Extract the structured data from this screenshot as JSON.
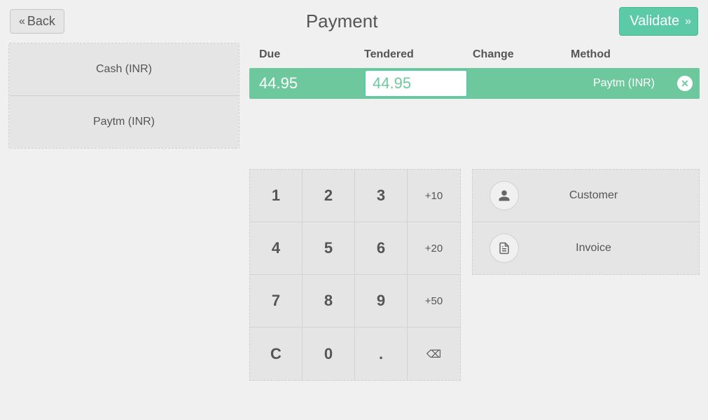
{
  "header": {
    "back_label": "Back",
    "title": "Payment",
    "validate_label": "Validate"
  },
  "methods": {
    "items": [
      {
        "label": "Cash (INR)"
      },
      {
        "label": "Paytm (INR)"
      }
    ]
  },
  "columns": {
    "due": "Due",
    "tendered": "Tendered",
    "change": "Change",
    "method": "Method"
  },
  "paymentline": {
    "due": "44.95",
    "tendered": "44.95",
    "change": "",
    "method": "Paytm (INR)"
  },
  "numpad": {
    "k1": "1",
    "k2": "2",
    "k3": "3",
    "p10": "+10",
    "k4": "4",
    "k5": "5",
    "k6": "6",
    "p20": "+20",
    "k7": "7",
    "k8": "8",
    "k9": "9",
    "p50": "+50",
    "kc": "C",
    "k0": "0",
    "kdot": ".",
    "kbsp": "⌫"
  },
  "actions": {
    "customer": "Customer",
    "invoice": "Invoice"
  }
}
